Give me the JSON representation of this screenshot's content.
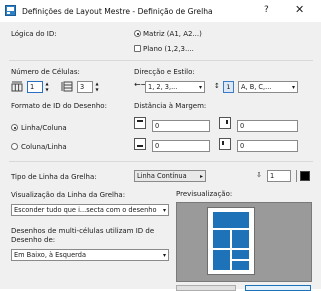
{
  "window": {
    "title": "Definições de Layout Mestre - Definição de Grelha",
    "help_glyph": "?",
    "close_glyph": "✕"
  },
  "id_logic": {
    "label": "Lógica do ID:",
    "options": [
      {
        "label": "Matriz (A1, A2...)",
        "selected": true
      },
      {
        "label": "Plano (1,2,3....",
        "selected": false
      }
    ]
  },
  "cells": {
    "label": "Número de Células:",
    "cols_value": "1",
    "rows_value": "3"
  },
  "direction": {
    "label": "Direcção e Estilo:",
    "horizontal_value": "1, 2, 3,...",
    "vertical_arrow": "1",
    "vertical_value": "A, B, C,..."
  },
  "id_format": {
    "label": "Formato de ID do Desenho:",
    "options": [
      {
        "label": "Linha/Coluna",
        "selected": true
      },
      {
        "label": "Coluna/Linha",
        "selected": false
      }
    ]
  },
  "margins": {
    "label": "Distância à Margem:",
    "top": "0",
    "right": "0",
    "bottom": "0",
    "left": "0"
  },
  "grid_line": {
    "label": "Tipo de Linha da Grelha:",
    "type_value": "Linha Contínua",
    "pen_value": "1"
  },
  "grid_view": {
    "label": "Visualização da Linha da Grelha:",
    "value": "Esconder tudo que i...secta com o desenho"
  },
  "multicell": {
    "label_line1": "Desenhos de multi-células utilizam ID de",
    "label_line2": "Desenho de:",
    "value": "Em Baixo, à Esquerda"
  },
  "preview": {
    "label": "Previsualização:"
  },
  "colors": {
    "accent": "#1e73b8"
  }
}
